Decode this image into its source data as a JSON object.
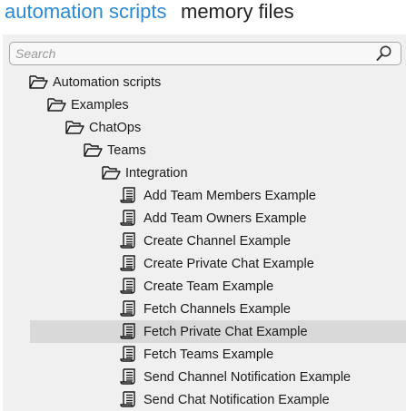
{
  "tabs": {
    "active": "automation scripts",
    "inactive": "memory files",
    "active_color": "#2a8ad4"
  },
  "search": {
    "placeholder": "Search",
    "value": "",
    "icon": "search-icon"
  },
  "tree": {
    "folders": [
      {
        "label": "Automation scripts",
        "icon": "folder-open-icon"
      },
      {
        "label": "Examples",
        "icon": "folder-open-icon"
      },
      {
        "label": "ChatOps",
        "icon": "folder-open-icon"
      },
      {
        "label": "Teams",
        "icon": "folder-open-icon"
      },
      {
        "label": "Integration",
        "icon": "folder-open-icon"
      }
    ],
    "scripts": [
      {
        "label": "Add Team Members Example",
        "icon": "script-icon"
      },
      {
        "label": "Add Team Owners Example",
        "icon": "script-icon"
      },
      {
        "label": "Create Channel Example",
        "icon": "script-icon"
      },
      {
        "label": "Create Private Chat Example",
        "icon": "script-icon"
      },
      {
        "label": "Create Team Example",
        "icon": "script-icon"
      },
      {
        "label": "Fetch Channels Example",
        "icon": "script-icon"
      },
      {
        "label": "Fetch Private Chat Example",
        "icon": "script-icon",
        "selected": true
      },
      {
        "label": "Fetch Teams Example",
        "icon": "script-icon"
      },
      {
        "label": "Send Channel Notification Example",
        "icon": "script-icon"
      },
      {
        "label": "Send Chat Notification Example",
        "icon": "script-icon"
      }
    ],
    "selected_color": "#d9d9d9"
  }
}
